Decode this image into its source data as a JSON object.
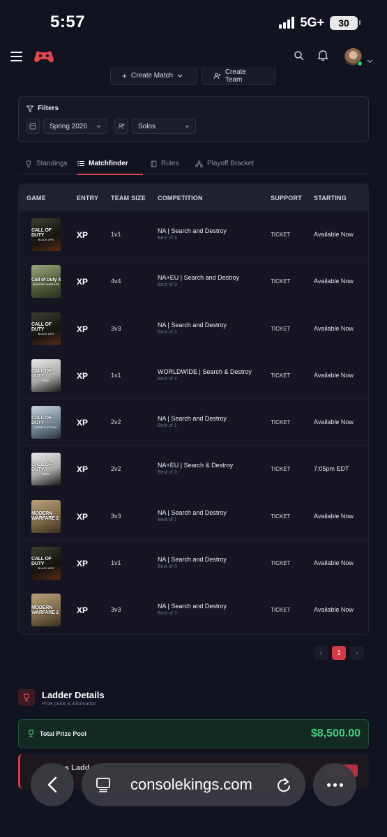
{
  "status_bar": {
    "time": "5:57",
    "network": "5G+",
    "battery": "30"
  },
  "header": {
    "icons": [
      "menu-icon",
      "logo-icon",
      "search-icon",
      "bell-icon",
      "avatar",
      "chevron-down-icon"
    ]
  },
  "actions": {
    "create_match": "Create Match",
    "create_team": "Create Team"
  },
  "filters": {
    "title": "Filters",
    "season": "Spring 2026",
    "mode": "Solos"
  },
  "tabs": [
    {
      "label": "Standings",
      "icon": "trophy-icon"
    },
    {
      "label": "Matchfinder",
      "icon": "list-icon"
    },
    {
      "label": "Rules",
      "icon": "book-icon"
    },
    {
      "label": "Playoff Bracket",
      "icon": "bracket-icon"
    }
  ],
  "table": {
    "headers": {
      "game": "GAME",
      "entry": "ENTRY",
      "team_size": "TEAM SIZE",
      "competition": "COMPETITION",
      "support": "SUPPORT",
      "starting": "STARTING"
    },
    "rows": [
      {
        "game": "CALL OF DUTY",
        "game_sub": "BLACK OPS",
        "entry": "XP",
        "team_size": "1v1",
        "competition": "NA | Search and Destroy",
        "best_of": "Best of 3",
        "support": "TICKET",
        "starting": "Available Now"
      },
      {
        "game": "Call of Duty 4",
        "game_sub": "MODERN WARFARE",
        "entry": "XP",
        "team_size": "4v4",
        "competition": "NA+EU | Search and Destroy",
        "best_of": "Best of 3",
        "support": "TICKET",
        "starting": "Available Now"
      },
      {
        "game": "CALL OF DUTY",
        "game_sub": "BLACK OPS",
        "entry": "XP",
        "team_size": "3v3",
        "competition": "NA | Search and Destroy",
        "best_of": "Best of 3",
        "support": "TICKET",
        "starting": "Available Now"
      },
      {
        "game": "CALL OF DUTY",
        "game_sub": "MW3",
        "entry": "XP",
        "team_size": "1v1",
        "competition": "WORLDWIDE | Search & Destroy",
        "best_of": "Best of 3",
        "support": "TICKET",
        "starting": "Available Now"
      },
      {
        "game": "CALL OF DUTY",
        "game_sub": "WORLD AT WAR",
        "entry": "XP",
        "team_size": "2v2",
        "competition": "NA | Search and Destroy",
        "best_of": "Best of 1",
        "support": "TICKET",
        "starting": "Available Now"
      },
      {
        "game": "CALL OF DUTY",
        "game_sub": "MW3",
        "entry": "XP",
        "team_size": "2v2",
        "competition": "NA+EU | Search & Destroy",
        "best_of": "Best of 3",
        "support": "TICKET",
        "starting": "7:05pm EDT"
      },
      {
        "game": "MODERN WARFARE 2",
        "game_sub": "",
        "entry": "XP",
        "team_size": "3v3",
        "competition": "NA | Search and Destroy",
        "best_of": "Best of 1",
        "support": "TICKET",
        "starting": "Available Now"
      },
      {
        "game": "CALL OF DUTY",
        "game_sub": "BLACK OPS",
        "entry": "XP",
        "team_size": "1v1",
        "competition": "NA | Search and Destroy",
        "best_of": "Best of 3",
        "support": "TICKET",
        "starting": "Available Now"
      },
      {
        "game": "MODERN WARFARE 2",
        "game_sub": "",
        "entry": "XP",
        "team_size": "3v3",
        "competition": "NA | Search and Destroy",
        "best_of": "Best of 3",
        "support": "TICKET",
        "starting": "Available Now"
      }
    ]
  },
  "pagination": {
    "prev": "‹",
    "current": "1",
    "next": "›"
  },
  "ladder": {
    "title": "Ladder Details",
    "subtitle": "Prize pools & information",
    "prize_label": "Total Prize Pool",
    "prize_value": "$8,500.00",
    "second_label": "s Ladd"
  },
  "browser": {
    "url": "consolekings.com"
  },
  "colors": {
    "accent": "#d83a45",
    "prize": "#3ed07f",
    "background": "#121320"
  }
}
